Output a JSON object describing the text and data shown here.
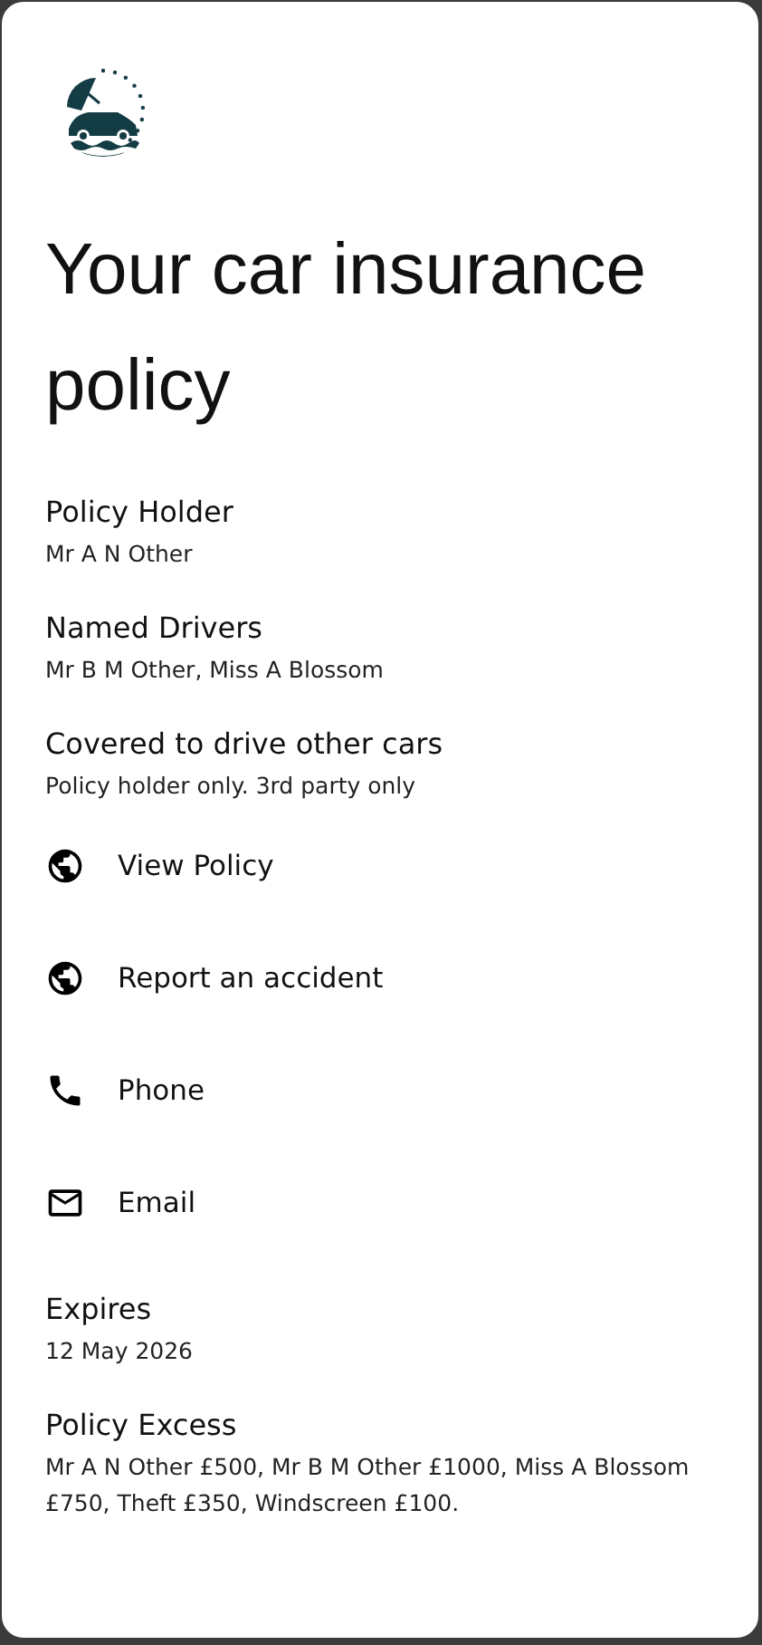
{
  "title": "Your car insurance policy",
  "items": [
    {
      "kind": "field",
      "label": "Policy Holder",
      "value": "Mr A N Other"
    },
    {
      "kind": "field",
      "label": "Named Drivers",
      "value": "Mr B M Other, Miss A Blossom"
    },
    {
      "kind": "field",
      "label": "Covered to drive other cars",
      "value": "Policy holder only. 3rd party only"
    },
    {
      "kind": "web",
      "label": "View Policy"
    },
    {
      "kind": "web",
      "label": "Report an accident"
    },
    {
      "kind": "phone",
      "label": "Phone"
    },
    {
      "kind": "email",
      "label": "Email"
    },
    {
      "kind": "field",
      "label": "Expires",
      "value": "12 May 2026"
    },
    {
      "kind": "field",
      "label": "Policy Excess",
      "value": "Mr A N Other £500, Mr B M Other £1000, Miss A Blossom £750, Theft £350, Windscreen £100."
    }
  ]
}
